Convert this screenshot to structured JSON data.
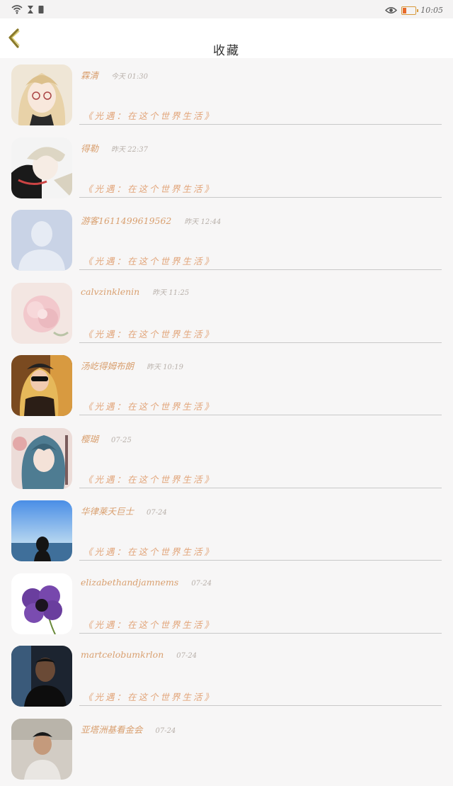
{
  "status_bar": {
    "time": "10:05",
    "battery_level": 0.3
  },
  "header": {
    "title": "收藏"
  },
  "items": [
    {
      "name": "霖清",
      "time": "今天 01:30",
      "title": "《光遇：在这个世界生活》",
      "avatar": "anime-girl-blonde"
    },
    {
      "name": "得勒",
      "time": "昨天 22:37",
      "title": "《光遇：在这个世界生活》",
      "avatar": "anime-boy-white-hair"
    },
    {
      "name": "游客1611499619562",
      "time": "昨天 12:44",
      "title": "《光遇：在这个世界生活》",
      "avatar": "default-user"
    },
    {
      "name": "calvzinklenin",
      "time": "昨天 11:25",
      "title": "《光遇：在这个世界生活》",
      "avatar": "pink-flower"
    },
    {
      "name": "汤屹得姆布朗",
      "time": "昨天 10:19",
      "title": "《光遇：在这个世界生活》",
      "avatar": "woman-sunglasses"
    },
    {
      "name": "樱瑚",
      "time": "07-25",
      "title": "《光遇：在这个世界生活》",
      "avatar": "anime-blue-hair"
    },
    {
      "name": "华律莱夭巨士",
      "time": "07-24",
      "title": "《光遇：在这个世界生活》",
      "avatar": "sky-sea-person"
    },
    {
      "name": "elizabethandjamnems",
      "time": "07-24",
      "title": "《光遇：在这个世界生活》",
      "avatar": "purple-flower"
    },
    {
      "name": "martcelobumkrlon",
      "time": "07-24",
      "title": "《光遇：在这个世界生活》",
      "avatar": "man-dark"
    },
    {
      "name": "亚塔洲基看金会",
      "time": "07-24",
      "title": "",
      "avatar": "man-light"
    }
  ]
}
